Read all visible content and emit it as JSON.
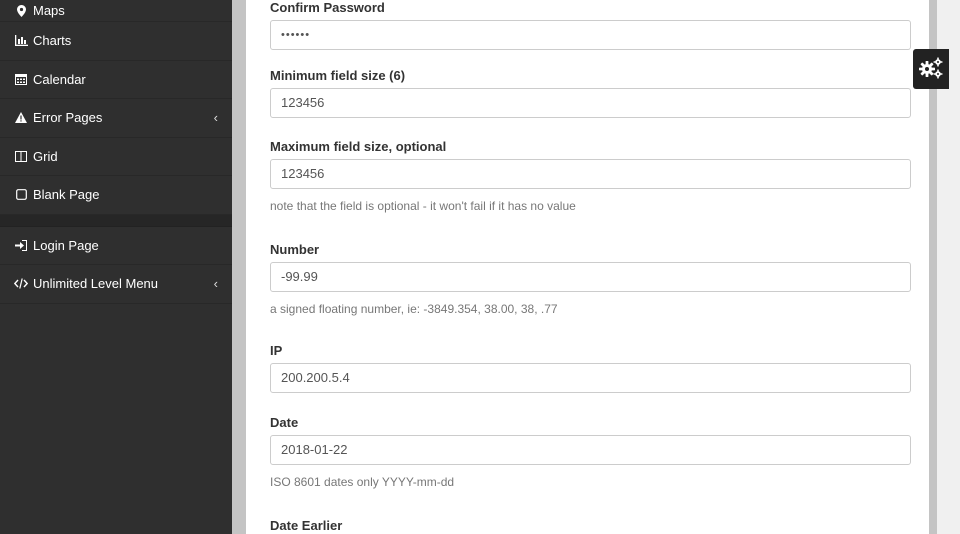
{
  "sidebar": {
    "items": [
      {
        "label": "Maps",
        "icon": "map-marker-icon"
      },
      {
        "label": "Charts",
        "icon": "bar-chart-icon"
      },
      {
        "label": "Calendar",
        "icon": "calendar-icon"
      },
      {
        "label": "Error Pages",
        "icon": "warning-icon",
        "chevron": "‹"
      },
      {
        "label": "Grid",
        "icon": "columns-icon"
      },
      {
        "label": "Blank Page",
        "icon": "square-icon"
      },
      {
        "label": "Login Page",
        "icon": "sign-in-icon"
      },
      {
        "label": "Unlimited Level Menu",
        "icon": "code-icon",
        "chevron": "‹"
      }
    ]
  },
  "form": {
    "confirm_password": {
      "label": "Confirm Password",
      "value": "••••••"
    },
    "min_size": {
      "label": "Minimum field size (6)",
      "value": "123456"
    },
    "max_size": {
      "label": "Maximum field size, optional",
      "value": "123456",
      "help": "note that the field is optional - it won't fail if it has no value"
    },
    "number": {
      "label": "Number",
      "value": "-99.99",
      "help": "a signed floating number, ie: -3849.354, 38.00, 38, .77"
    },
    "ip": {
      "label": "IP",
      "value": "200.200.5.4"
    },
    "date": {
      "label": "Date",
      "value": "2018-01-22",
      "help": "ISO 8601 dates only YYYY-mm-dd"
    },
    "date_earlier": {
      "label": "Date Earlier"
    }
  },
  "colors": {
    "sidebar_bg": "#2f2f2f",
    "settings_btn_bg": "#222222"
  }
}
